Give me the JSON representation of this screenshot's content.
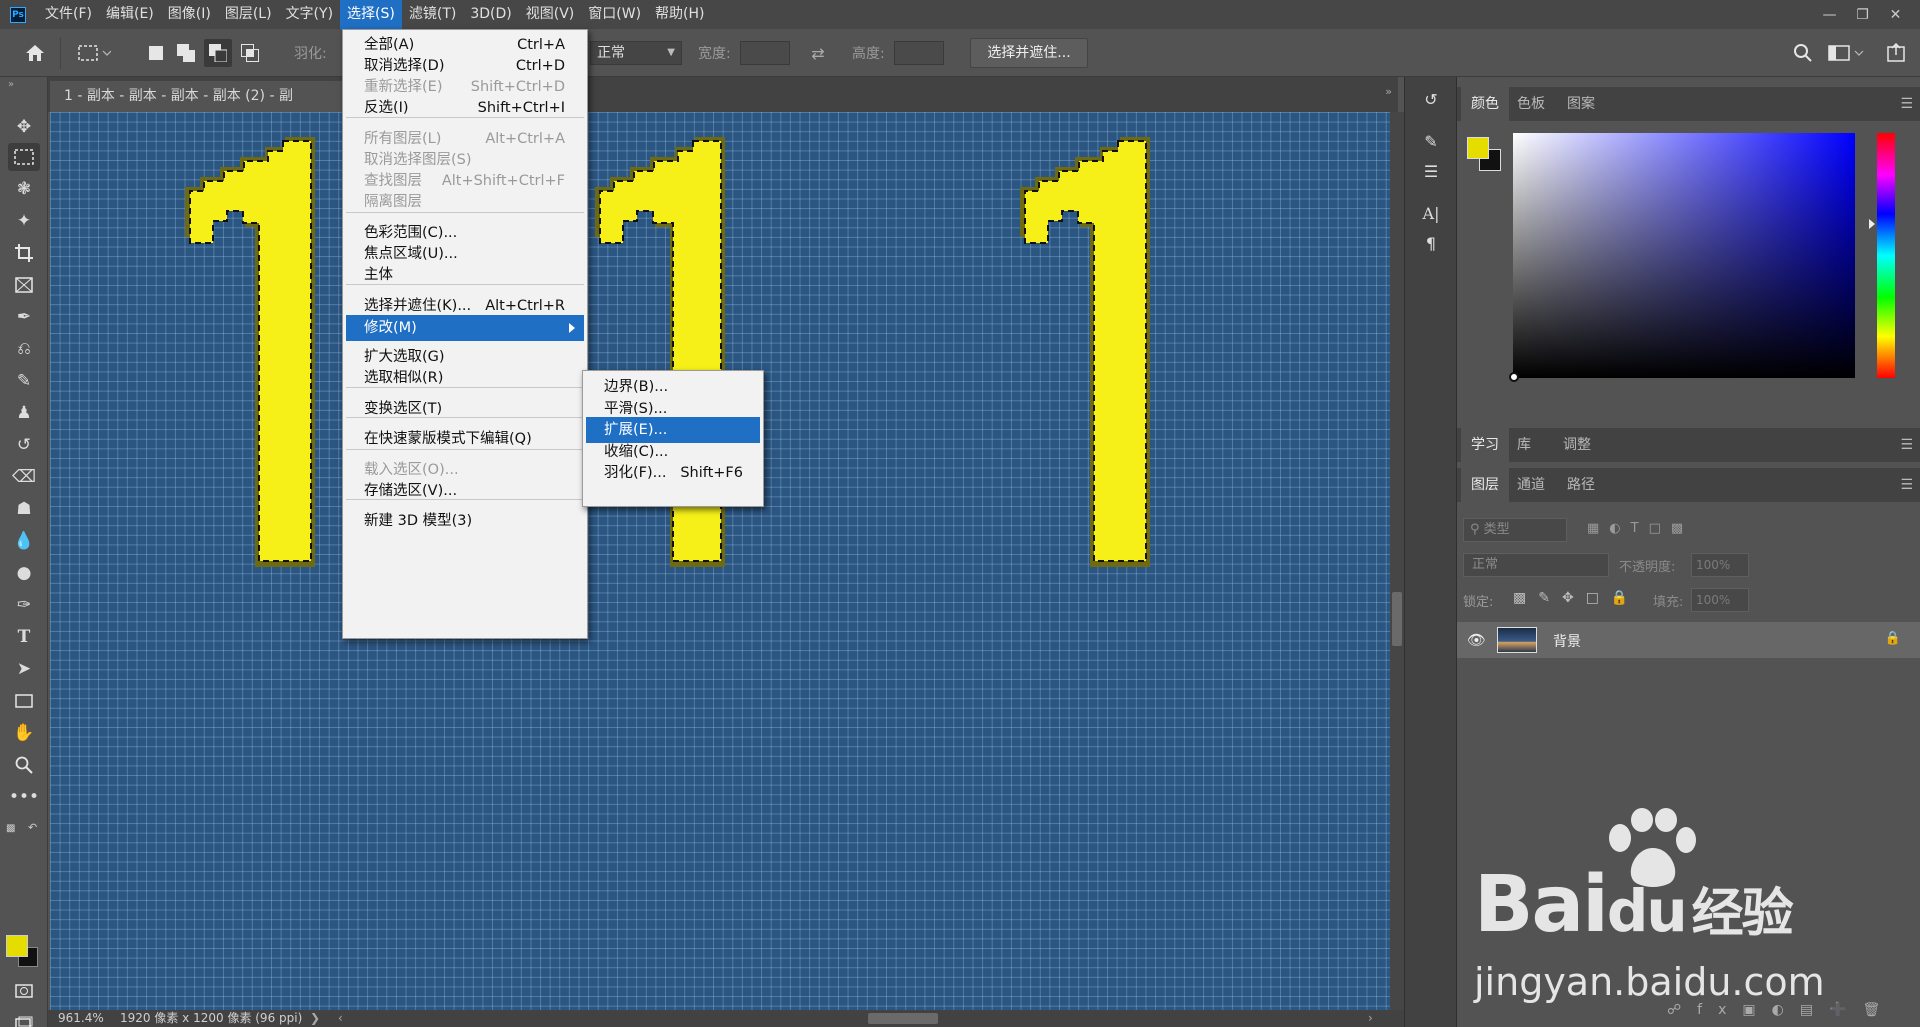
{
  "app": {
    "logo": "Ps"
  },
  "menubar": {
    "items": [
      "文件(F)",
      "编辑(E)",
      "图像(I)",
      "图层(L)",
      "文字(Y)",
      "选择(S)",
      "滤镜(T)",
      "3D(D)",
      "视图(V)",
      "窗口(W)",
      "帮助(H)"
    ],
    "active": "选择(S)"
  },
  "options_bar": {
    "feather_label": "羽化:",
    "style_value": "正常",
    "width_label": "宽度:",
    "height_label": "高度:",
    "refine_button": "选择并遮住..."
  },
  "document": {
    "tab_title": "1 - 副本 - 副本 - 副本 - 副本 (2) - 副",
    "zoom": "961.4%",
    "info": "1920 像素 x 1200 像素 (96 ppi)"
  },
  "colors": {
    "foreground": "#e5dc00",
    "background": "#111111",
    "canvas_bg": "#2b5682",
    "glyph_yellow": "#f6f018",
    "highlight": "#1f6fc5"
  },
  "select_menu": {
    "items": [
      {
        "label": "全部(A)",
        "shortcut": "Ctrl+A",
        "disabled": false
      },
      {
        "label": "取消选择(D)",
        "shortcut": "Ctrl+D",
        "disabled": false
      },
      {
        "label": "重新选择(E)",
        "shortcut": "Shift+Ctrl+D",
        "disabled": true
      },
      {
        "label": "反选(I)",
        "shortcut": "Shift+Ctrl+I",
        "disabled": false
      },
      {
        "label": "所有图层(L)",
        "shortcut": "Alt+Ctrl+A",
        "disabled": true
      },
      {
        "label": "取消选择图层(S)",
        "shortcut": "",
        "disabled": true
      },
      {
        "label": "查找图层",
        "shortcut": "Alt+Shift+Ctrl+F",
        "disabled": true
      },
      {
        "label": "隔离图层",
        "shortcut": "",
        "disabled": true
      },
      {
        "label": "色彩范围(C)...",
        "shortcut": "",
        "disabled": false
      },
      {
        "label": "焦点区域(U)...",
        "shortcut": "",
        "disabled": false
      },
      {
        "label": "主体",
        "shortcut": "",
        "disabled": false
      },
      {
        "label": "选择并遮住(K)...",
        "shortcut": "Alt+Ctrl+R",
        "disabled": false
      },
      {
        "label": "修改(M)",
        "shortcut": "",
        "disabled": false,
        "highlighted": true,
        "submenu": true
      },
      {
        "label": "扩大选取(G)",
        "shortcut": "",
        "disabled": false
      },
      {
        "label": "选取相似(R)",
        "shortcut": "",
        "disabled": false
      },
      {
        "label": "变换选区(T)",
        "shortcut": "",
        "disabled": false
      },
      {
        "label": "在快速蒙版模式下编辑(Q)",
        "shortcut": "",
        "disabled": false
      },
      {
        "label": "载入选区(O)...",
        "shortcut": "",
        "disabled": true
      },
      {
        "label": "存储选区(V)...",
        "shortcut": "",
        "disabled": false
      },
      {
        "label": "新建 3D 模型(3)",
        "shortcut": "",
        "disabled": false
      }
    ]
  },
  "modify_submenu": {
    "items": [
      {
        "label": "边界(B)...",
        "shortcut": ""
      },
      {
        "label": "平滑(S)...",
        "shortcut": ""
      },
      {
        "label": "扩展(E)...",
        "shortcut": "",
        "highlighted": true
      },
      {
        "label": "收缩(C)...",
        "shortcut": ""
      },
      {
        "label": "羽化(F)...",
        "shortcut": "Shift+F6"
      }
    ]
  },
  "panels": {
    "color_tabs": [
      "颜色",
      "色板",
      "图案"
    ],
    "learn_tabs": [
      "学习",
      "库",
      "调整"
    ],
    "layer_tabs": [
      "图层",
      "通道",
      "路径"
    ],
    "filter_placeholder": "类型",
    "blend_mode": "正常",
    "opacity_label": "不透明度:",
    "opacity_value": "100%",
    "lock_label": "锁定:",
    "fill_label": "填充:",
    "fill_value": "100%",
    "layer_name": "背景"
  },
  "watermark": {
    "brand": "Bai",
    "brand2": "du",
    "suffix": "经验",
    "url": "jingyan.baidu.com"
  }
}
